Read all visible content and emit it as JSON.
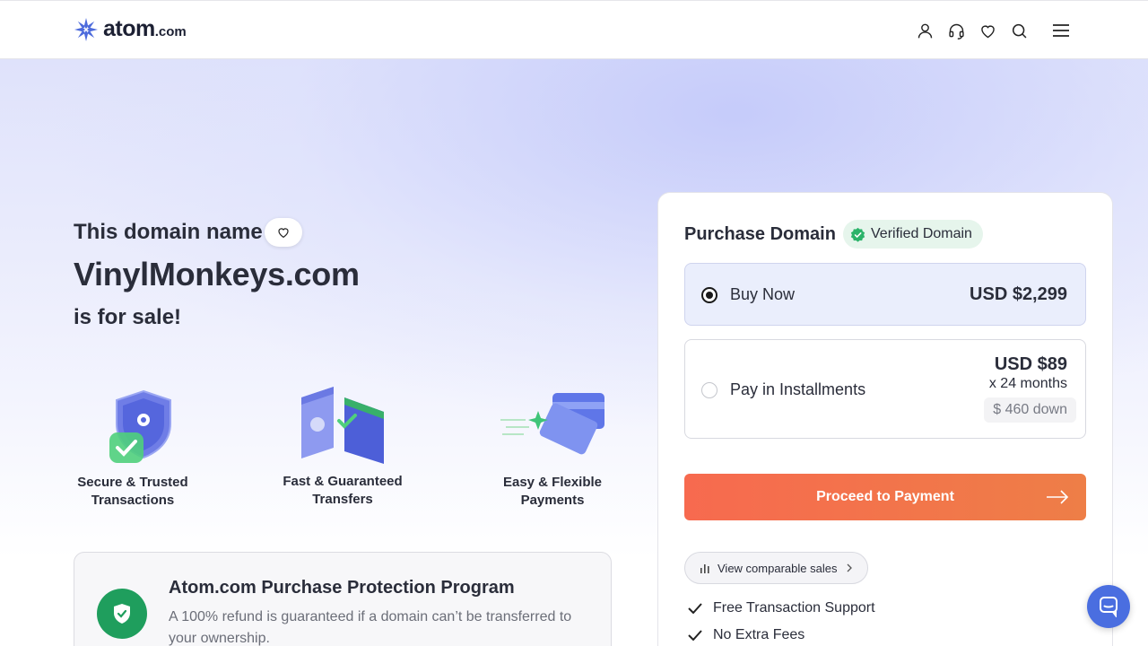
{
  "header": {
    "logo_text": "atom",
    "logo_tld": ".com",
    "icons": [
      "user-icon",
      "headset-icon",
      "heart-icon",
      "search-icon",
      "menu-icon"
    ]
  },
  "hero": {
    "heading": "This domain name",
    "domain": "VinylMonkeys.com",
    "subheading": "is for sale!"
  },
  "features": [
    {
      "label": "Secure & Trusted Transactions",
      "icon": "shield-icon"
    },
    {
      "label": "Fast & Guaranteed Transfers",
      "icon": "transfer-icon"
    },
    {
      "label": "Easy & Flexible Payments",
      "icon": "card-icon"
    }
  ],
  "protection": {
    "title": "Atom.com Purchase Protection Program",
    "description": "A 100% refund is guaranteed if a domain can’t be transferred to your ownership."
  },
  "purchase": {
    "title": "Purchase Domain",
    "verified_label": "Verified Domain",
    "options": [
      {
        "label": "Buy Now",
        "price": "USD $2,299",
        "selected": true
      },
      {
        "label": "Pay in Installments",
        "price": "USD $89",
        "term": "x 24 months",
        "down": "$ 460 down",
        "selected": false
      }
    ],
    "proceed_label": "Proceed to Payment",
    "comparable_label": "View comparable sales",
    "benefits": [
      "Free Transaction Support",
      "No Extra Fees"
    ]
  },
  "colors": {
    "accent_orange": "#f76a4f",
    "verified_green": "#1f9e5d",
    "brand_blue": "#4a6ee0"
  }
}
